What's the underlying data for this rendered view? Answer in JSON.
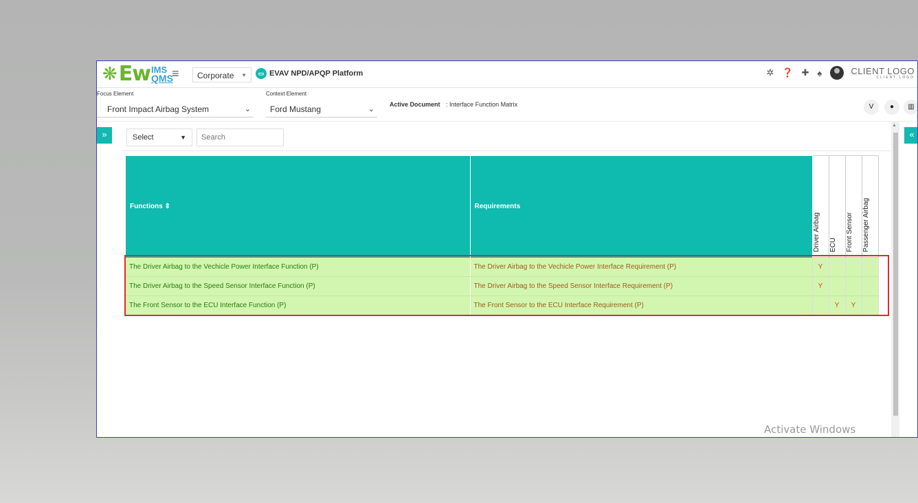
{
  "header": {
    "logo_ew": "Ew",
    "logo_ims": "IMS",
    "logo_qms": "QMS",
    "org_select": "Corporate",
    "platform_title": "EVAV NPD/APQP Platform",
    "client_logo": "CLIENT LOGO",
    "client_logo_sub": "CLIENT LOGO"
  },
  "focus": {
    "focus_label": "Focus Element",
    "focus_value": "Front Impact Airbag System",
    "context_label": "Context Element",
    "context_value": "Ford Mustang",
    "active_doc_label": "Active Document",
    "active_doc_value": ": Interface Function Matrix"
  },
  "filter": {
    "select_value": "Select",
    "search_placeholder": "Search"
  },
  "table": {
    "col_functions": "Functions ⇕",
    "col_requirements": "Requirements",
    "matrix_columns": [
      "Driver Airbag",
      "ECU",
      "Front Sensor",
      "Passenger Airbag"
    ],
    "rows": [
      {
        "function": "The Driver Airbag to the Vechicle Power Interface Function (P)",
        "requirement": "The Driver Airbag to the Vechicle Power Interface Requirement (P)",
        "marks": [
          "Y",
          "",
          "",
          ""
        ]
      },
      {
        "function": "The Driver Airbag to the Speed Sensor Interface Function (P)",
        "requirement": "The Driver Airbag to the Speed Sensor Interface Requirement (P)",
        "marks": [
          "Y",
          "",
          "",
          ""
        ]
      },
      {
        "function": "The Front Sensor to the ECU Interface Function (P)",
        "requirement": "The Front Sensor to the ECU Interface Requirement (P)",
        "marks": [
          "",
          "Y",
          "Y",
          ""
        ]
      }
    ]
  },
  "watermark": "Activate Windows",
  "colors": {
    "accent": "#0fbaaf",
    "row_bg": "#d2f6b0",
    "highlight": "#e02a2a"
  }
}
